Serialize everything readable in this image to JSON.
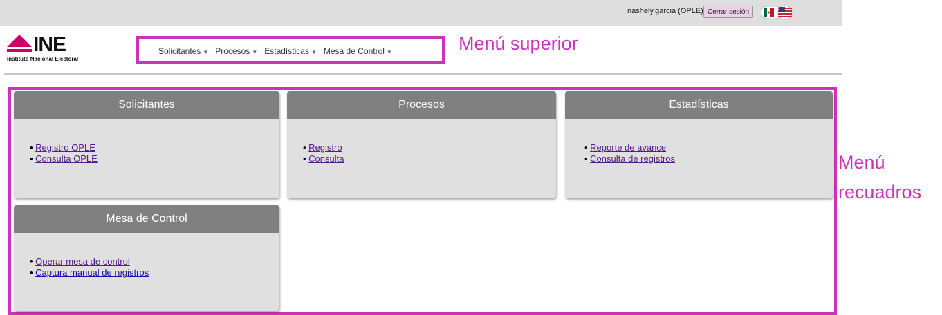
{
  "topbar": {
    "user": "nashely.garcia (OPLE)",
    "logout_label": "Cerrar sesión"
  },
  "brand": {
    "name": "INE",
    "subtitle": "Instituto Nacional Electoral",
    "color": "#cc0066"
  },
  "nav": {
    "items": [
      {
        "label": "Solicitantes"
      },
      {
        "label": "Procesos"
      },
      {
        "label": "Estadísticas"
      },
      {
        "label": "Mesa de Control"
      }
    ]
  },
  "annotations": {
    "top_menu": "Menú superior",
    "box_menu_line1": "Menú",
    "box_menu_line2": "recuadros",
    "color": "#cc33bb"
  },
  "cards": [
    {
      "title": "Solicitantes",
      "links": [
        {
          "label": "Registro OPLE"
        },
        {
          "label": "Consulta OPLE"
        }
      ]
    },
    {
      "title": "Procesos",
      "links": [
        {
          "label": "Registro"
        },
        {
          "label": "Consulta"
        }
      ]
    },
    {
      "title": "Estadísticas",
      "links": [
        {
          "label": "Reporte de avance"
        },
        {
          "label": "Consulta de registros"
        }
      ]
    },
    {
      "title": "Mesa de Control",
      "links": [
        {
          "label": "Operar mesa de control"
        },
        {
          "label": "Captura manual de registros"
        }
      ]
    }
  ]
}
